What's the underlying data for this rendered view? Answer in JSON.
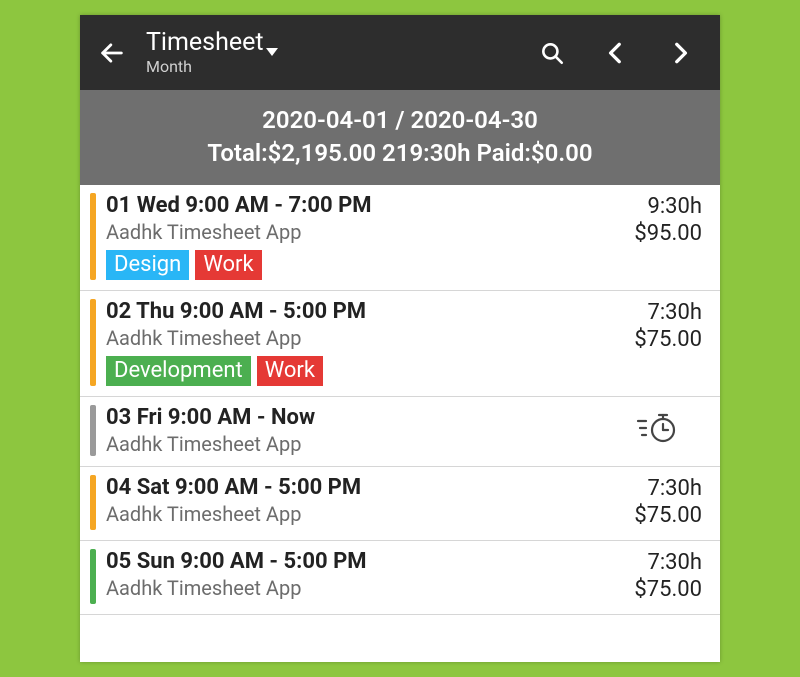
{
  "toolbar": {
    "title": "Timesheet",
    "subtitle": "Month"
  },
  "summary": {
    "date_range": "2020-04-01 / 2020-04-30",
    "totals_line": "Total:$2,195.00 219:30h Paid:$0.00"
  },
  "stripe_colors": {
    "orange": "#f5a623",
    "gray": "#9a9a9a",
    "green": "#4caf50"
  },
  "tag_colors": {
    "blue": "#29b6f6",
    "red": "#e53935",
    "green": "#4caf50"
  },
  "entries": [
    {
      "stripe": "orange",
      "headline": "01 Wed  9:00 AM - 7:00 PM",
      "subline": "Aadhk  Timesheet App",
      "hours": "9:30h",
      "amount": "$95.00",
      "tags": [
        {
          "label": "Design",
          "color": "blue"
        },
        {
          "label": "Work",
          "color": "red"
        }
      ]
    },
    {
      "stripe": "orange",
      "headline": "02 Thu  9:00 AM - 5:00 PM",
      "subline": "Aadhk  Timesheet App",
      "hours": "7:30h",
      "amount": "$75.00",
      "tags": [
        {
          "label": "Development",
          "color": "green"
        },
        {
          "label": "Work",
          "color": "red"
        }
      ]
    },
    {
      "stripe": "gray",
      "headline": "03 Fri  9:00 AM - Now",
      "subline": "Aadhk  Timesheet App",
      "running": true
    },
    {
      "stripe": "orange",
      "headline": "04 Sat  9:00 AM - 5:00 PM",
      "subline": "Aadhk  Timesheet App",
      "hours": "7:30h",
      "amount": "$75.00"
    },
    {
      "stripe": "green",
      "headline": "05 Sun  9:00 AM - 5:00 PM",
      "subline": "Aadhk  Timesheet App",
      "hours": "7:30h",
      "amount": "$75.00"
    }
  ]
}
